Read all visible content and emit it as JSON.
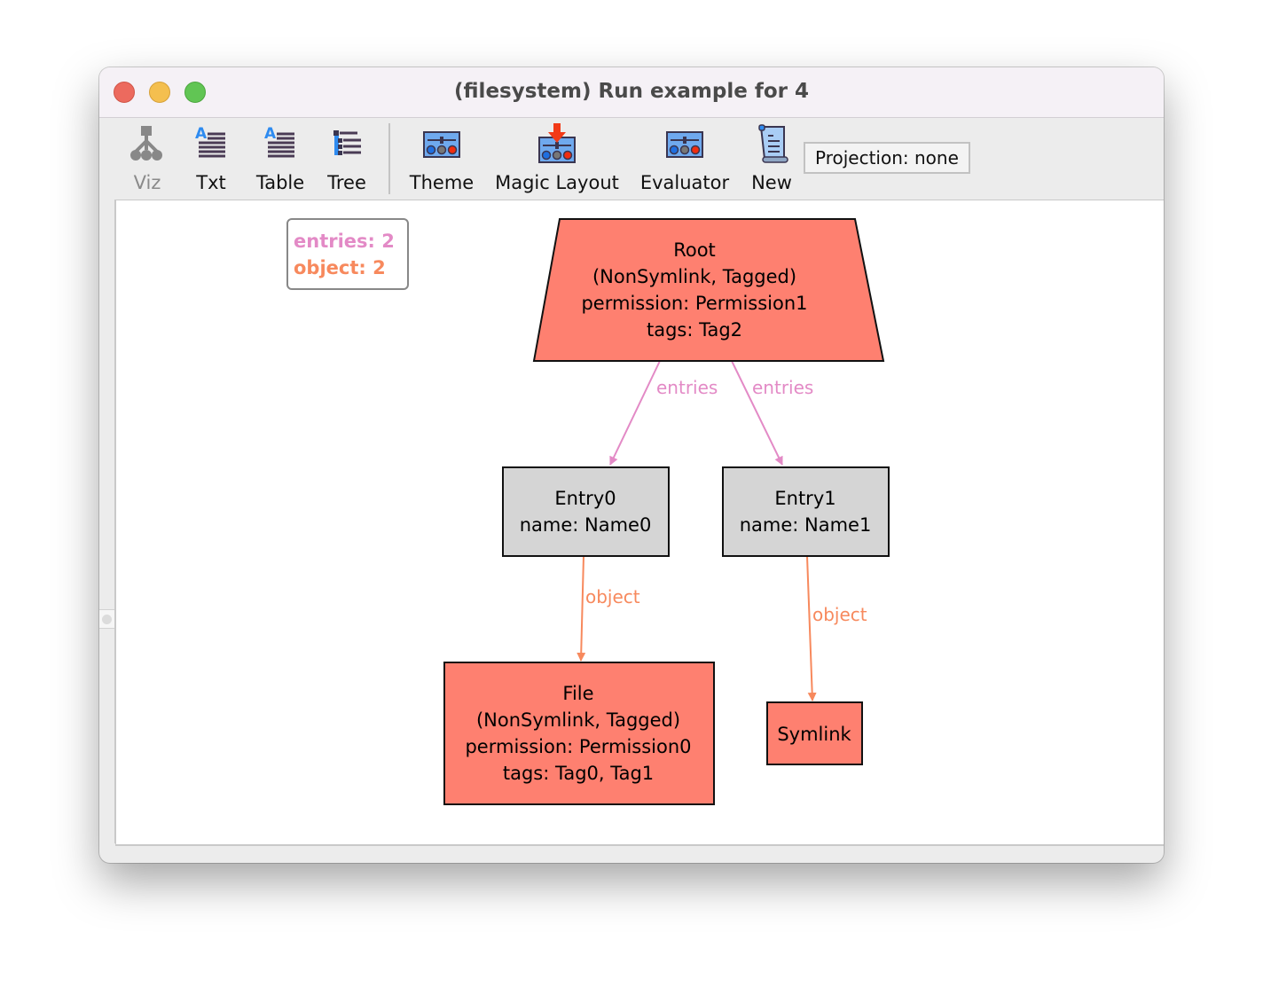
{
  "window": {
    "title": "(filesystem) Run example for 4",
    "traffic_lights": [
      "close",
      "minimize",
      "maximize"
    ]
  },
  "toolbar": {
    "buttons": [
      {
        "id": "viz",
        "label": "Viz",
        "icon": "tree-graph-icon",
        "enabled": false
      },
      {
        "id": "txt",
        "label": "Txt",
        "icon": "text-document-icon",
        "enabled": true
      },
      {
        "id": "table",
        "label": "Table",
        "icon": "table-text-icon",
        "enabled": true
      },
      {
        "id": "tree",
        "label": "Tree",
        "icon": "tree-list-icon",
        "enabled": true
      },
      {
        "id": "theme",
        "label": "Theme",
        "icon": "theme-sliders-icon",
        "enabled": true
      },
      {
        "id": "magic_layout",
        "label": "Magic Layout",
        "icon": "magic-layout-icon",
        "enabled": true
      },
      {
        "id": "evaluator",
        "label": "Evaluator",
        "icon": "evaluator-sliders-icon",
        "enabled": true
      },
      {
        "id": "new",
        "label": "New",
        "icon": "scroll-document-icon",
        "enabled": true
      }
    ],
    "projection_label": "Projection: none"
  },
  "legend": {
    "items": [
      {
        "label": "entries: 2",
        "color": "#e38ac6"
      },
      {
        "label": "object: 2",
        "color": "#f7895d"
      }
    ]
  },
  "graph": {
    "colors": {
      "signature_node": "#fe8070",
      "entry_node": "#d5d5d5",
      "entries_edge": "#e38ac6",
      "object_edge": "#f7895d",
      "outline": "#111111"
    },
    "nodes": [
      {
        "id": "root",
        "shape": "trapezium",
        "kind": "signature",
        "lines": [
          "Root",
          "(NonSymlink, Tagged)",
          "permission: Permission1",
          "tags: Tag2"
        ]
      },
      {
        "id": "entry0",
        "shape": "box",
        "kind": "entry",
        "lines": [
          "Entry0",
          "name: Name0"
        ]
      },
      {
        "id": "entry1",
        "shape": "box",
        "kind": "entry",
        "lines": [
          "Entry1",
          "name: Name1"
        ]
      },
      {
        "id": "file",
        "shape": "box",
        "kind": "signature",
        "lines": [
          "File",
          "(NonSymlink, Tagged)",
          "permission: Permission0",
          "tags: Tag0, Tag1"
        ]
      },
      {
        "id": "symlink",
        "shape": "box",
        "kind": "signature",
        "lines": [
          "Symlink"
        ]
      }
    ],
    "edges": [
      {
        "from": "root",
        "to": "entry0",
        "label": "entries",
        "relation": "entries"
      },
      {
        "from": "root",
        "to": "entry1",
        "label": "entries",
        "relation": "entries"
      },
      {
        "from": "entry0",
        "to": "file",
        "label": "object",
        "relation": "object"
      },
      {
        "from": "entry1",
        "to": "symlink",
        "label": "object",
        "relation": "object"
      }
    ]
  }
}
